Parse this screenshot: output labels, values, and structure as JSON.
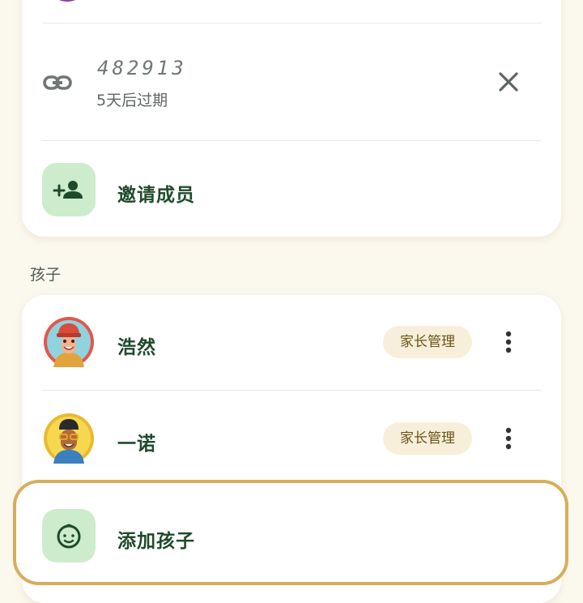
{
  "invite": {
    "code": "482913",
    "expiry": "5天后过期",
    "invite_label": "邀请成员"
  },
  "children_section": {
    "title": "孩子",
    "children": [
      {
        "name": "浩然",
        "badge": "家长管理"
      },
      {
        "name": "一诺",
        "badge": "家长管理"
      }
    ],
    "add_label": "添加孩子"
  },
  "icons": {
    "link": "link-icon",
    "revoke": "close-icon",
    "invite": "person-add-icon",
    "more": "more-vertical-icon",
    "add_child": "child-face-icon"
  },
  "colors": {
    "page_bg": "#fbf8ee",
    "accent_green": "#1e4a2b",
    "tile_green": "#cdeccb",
    "badge_bg": "#f8efda",
    "highlight_border": "#d8ad5b"
  }
}
